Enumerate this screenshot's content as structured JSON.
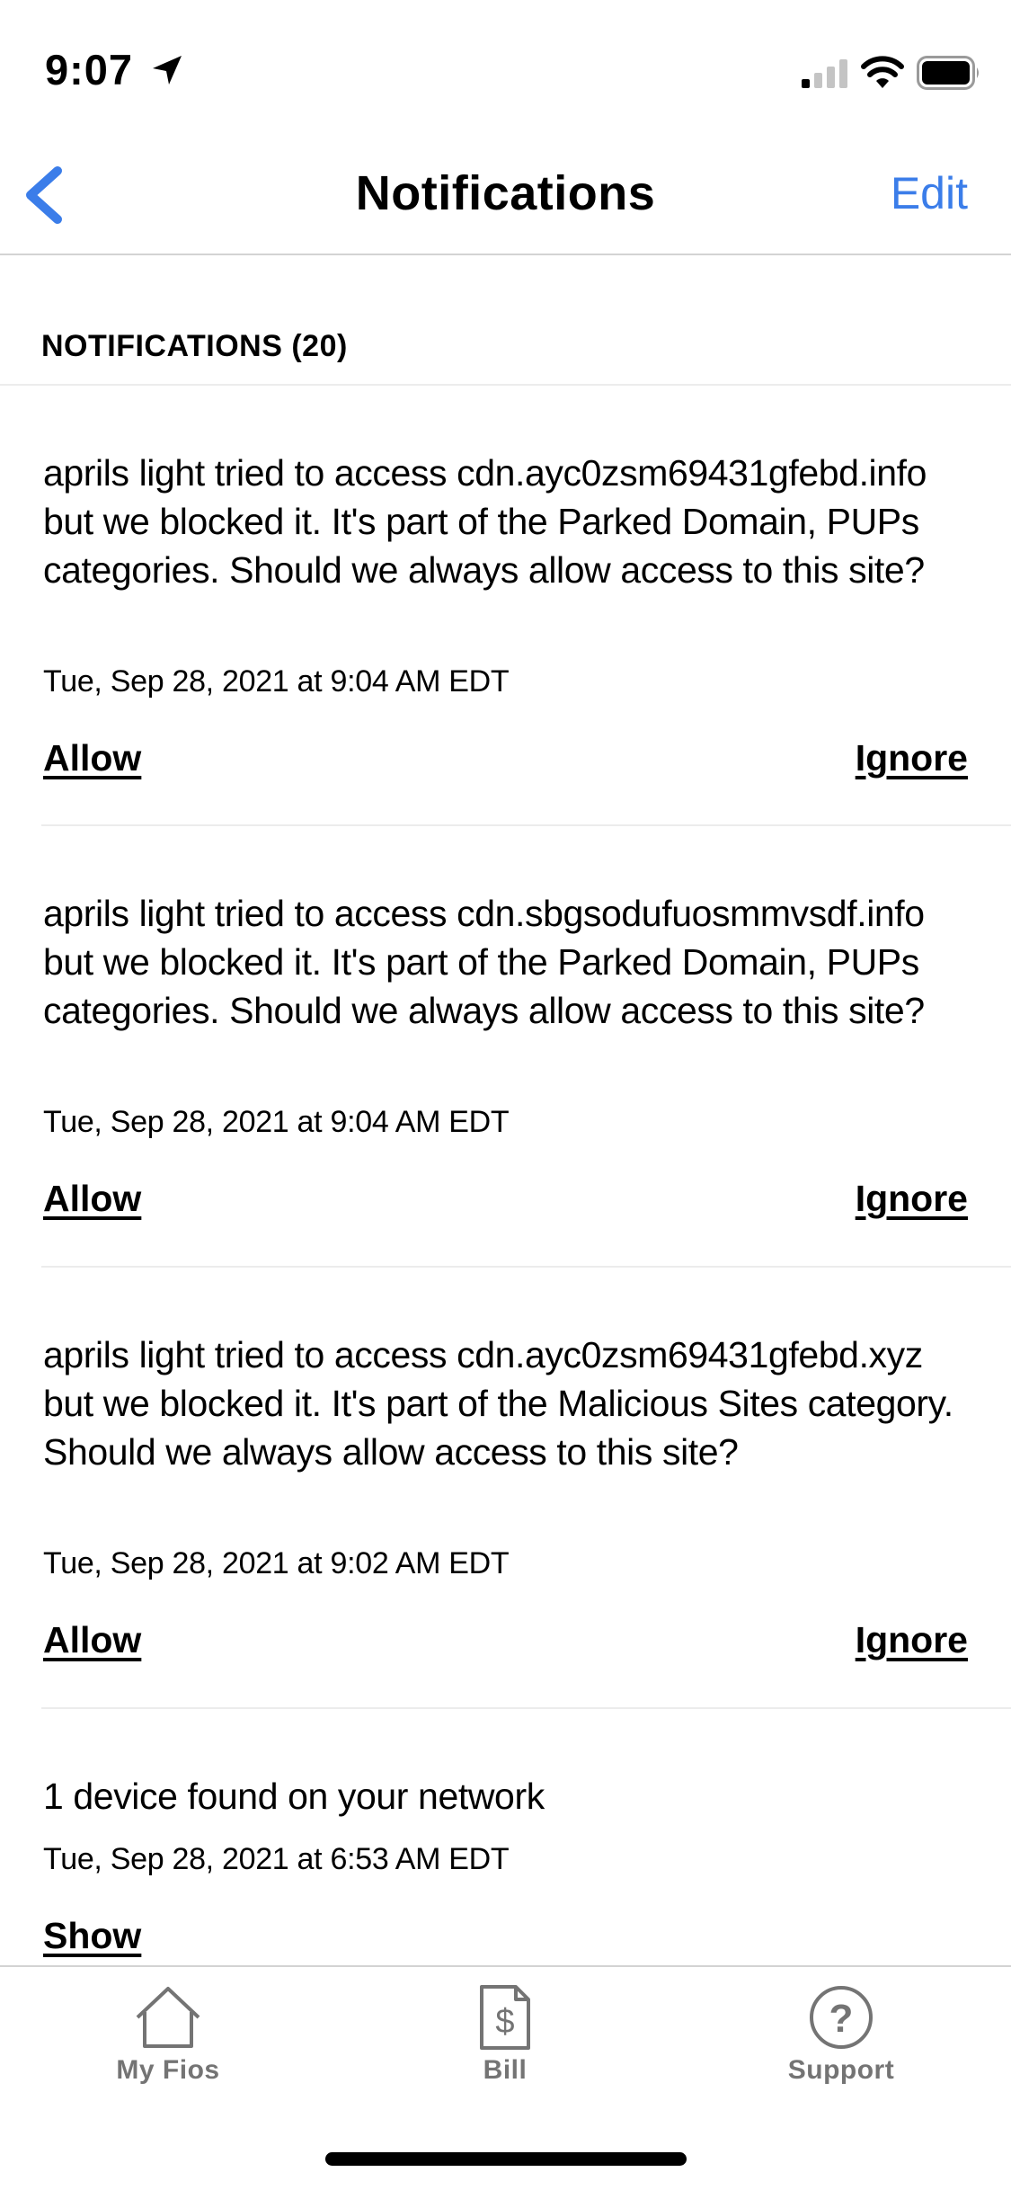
{
  "status_bar": {
    "time": "9:07"
  },
  "nav": {
    "title": "Notifications",
    "edit_label": "Edit"
  },
  "section": {
    "header": "NOTIFICATIONS (20)"
  },
  "notifications": [
    {
      "message": "aprils light tried to access cdn.ayc0zsm69431gfebd.info but we blocked it. It's part of the Parked Domain, PUPs categories. Should we always allow access to this site?",
      "time": "Tue, Sep 28, 2021 at 9:04 AM EDT",
      "primary_action": "Allow",
      "secondary_action": "Ignore"
    },
    {
      "message": "aprils light tried to access cdn.sbgsodufuosmmvsdf.info but we blocked it. It's part of the Parked Domain, PUPs categories. Should we always allow access to this site?",
      "time": "Tue, Sep 28, 2021 at 9:04 AM EDT",
      "primary_action": "Allow",
      "secondary_action": "Ignore"
    },
    {
      "message": "aprils light tried to access cdn.ayc0zsm69431gfebd.xyz but we blocked it. It's part of the Malicious Sites category. Should we always allow access to this site?",
      "time": "Tue, Sep 28, 2021 at 9:02 AM EDT",
      "primary_action": "Allow",
      "secondary_action": "Ignore"
    },
    {
      "message": "1 device found on your network",
      "time": "Tue, Sep 28, 2021 at 6:53 AM EDT",
      "primary_action": "Show"
    }
  ],
  "tab_bar": {
    "tabs": [
      {
        "label": "My Fios",
        "icon": "home-icon"
      },
      {
        "label": "Bill",
        "icon": "bill-icon"
      },
      {
        "label": "Support",
        "icon": "help-icon"
      }
    ]
  },
  "colors": {
    "accent": "#3b7de9",
    "tab_inactive": "#747474",
    "divider": "#ececec"
  }
}
